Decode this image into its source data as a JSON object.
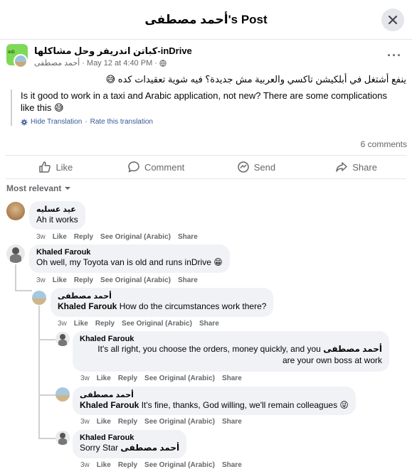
{
  "header": {
    "title": "أحمد مصطفى's Post"
  },
  "post": {
    "group_name": "كباتن اندريفر وحل مشاكلها-inDrive",
    "author": "أحمد مصطفى",
    "date": "May 12 at 4:40 PM",
    "separator": "·",
    "text": "ينفع أشتغل في أبلكيشن تاكسي والعربية مش جديدة؟ فيه شوية تعقيدات كده 😅",
    "translation": "Is it good to work in a taxi and Arabic application, not new? There are some complications like this 😅",
    "hide_translation": "Hide Translation",
    "rate_translation": "Rate this translation",
    "comment_count": "6 comments"
  },
  "actions": {
    "like": "Like",
    "comment": "Comment",
    "send": "Send",
    "share": "Share"
  },
  "sort_label": "Most relevant",
  "comment_actions": {
    "like": "Like",
    "reply": "Reply",
    "see_original": "See Original (Arabic)",
    "share": "Share",
    "time": "3w"
  },
  "comments": [
    {
      "author": "عيد عسليه",
      "text": "Ah it works"
    },
    {
      "author": "Khaled Farouk",
      "text": "Oh well, my Toyota van is old and runs inDrive 😁"
    },
    {
      "author": "أحمد مصطفى",
      "mention": "Khaled Farouk",
      "text": " How do the circumstances work there?"
    },
    {
      "author": "Khaled Farouk",
      "text_line1": "It's all right, you choose the orders, money quickly, and you",
      "mention": "أحمد مصطفى",
      "text_line2": "are your own boss at work"
    },
    {
      "author": "أحمد مصطفى",
      "mention": "Khaled Farouk",
      "text": " It's fine, thanks, God willing, we'll remain colleagues 😜"
    },
    {
      "author": "Khaled Farouk",
      "text": "Sorry Star ",
      "mention": "أحمد مصطفى"
    }
  ],
  "icons": [
    "close-icon",
    "globe-icon",
    "more-icon",
    "gear-icon",
    "like-icon",
    "comment-icon",
    "send-icon",
    "share-icon",
    "chevron-down-icon"
  ]
}
